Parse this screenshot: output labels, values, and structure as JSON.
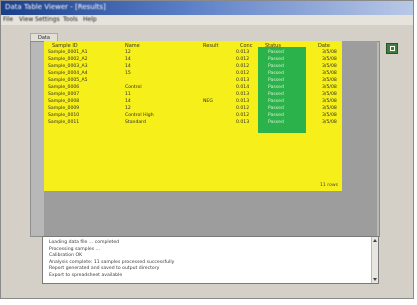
{
  "window": {
    "title": "Data Table Viewer - [Results]"
  },
  "menu": [
    "File",
    "View",
    "Settings",
    "Tools",
    "Help"
  ],
  "tab": {
    "label": "Data"
  },
  "table": {
    "columns": [
      "Sample ID",
      "Name",
      "Result",
      "Conc",
      "Status",
      "Date"
    ],
    "rows": [
      [
        "Sample_0001_A1",
        "12",
        "",
        "0.013",
        "Passed",
        "3/5/08"
      ],
      [
        "Sample_0002_A2",
        "14",
        "",
        "0.012",
        "Passed",
        "3/5/08"
      ],
      [
        "Sample_0003_A3",
        "14",
        "",
        "0.012",
        "Passed",
        "3/5/08"
      ],
      [
        "Sample_0004_A4",
        "15",
        "",
        "0.012",
        "Passed",
        "3/5/08"
      ],
      [
        "Sample_0005_A5",
        "",
        "",
        "0.013",
        "Passed",
        "3/5/08"
      ],
      [
        "Sample_0006",
        "Control",
        "",
        "0.014",
        "Passed",
        "3/5/08"
      ],
      [
        "Sample_0007",
        "11",
        "",
        "0.013",
        "Passed",
        "3/5/08"
      ],
      [
        "Sample_0008",
        "14",
        "NEG",
        "0.013",
        "Passed",
        "3/5/08"
      ],
      [
        "Sample_0009",
        "12",
        "",
        "0.012",
        "Passed",
        "3/5/08"
      ],
      [
        "Sample_0010",
        "Control High",
        "",
        "0.012",
        "Passed",
        "3/5/08"
      ],
      [
        "Sample_0011",
        "Standard",
        "",
        "0.013",
        "Passed",
        "3/5/08"
      ]
    ],
    "status": "11 rows"
  },
  "log": {
    "lines": [
      "Loading data file ... completed",
      "Processing samples ...",
      "Calibration OK",
      "Analysis complete: 11 samples processed successfully",
      "Report generated and saved to output directory",
      "Export to spreadsheet available"
    ]
  },
  "icons": {
    "export": "excel-export-icon"
  },
  "colors": {
    "highlight": "#f6ef1a",
    "status_ok": "#2bb24b",
    "panel": "#9d9d9d"
  }
}
